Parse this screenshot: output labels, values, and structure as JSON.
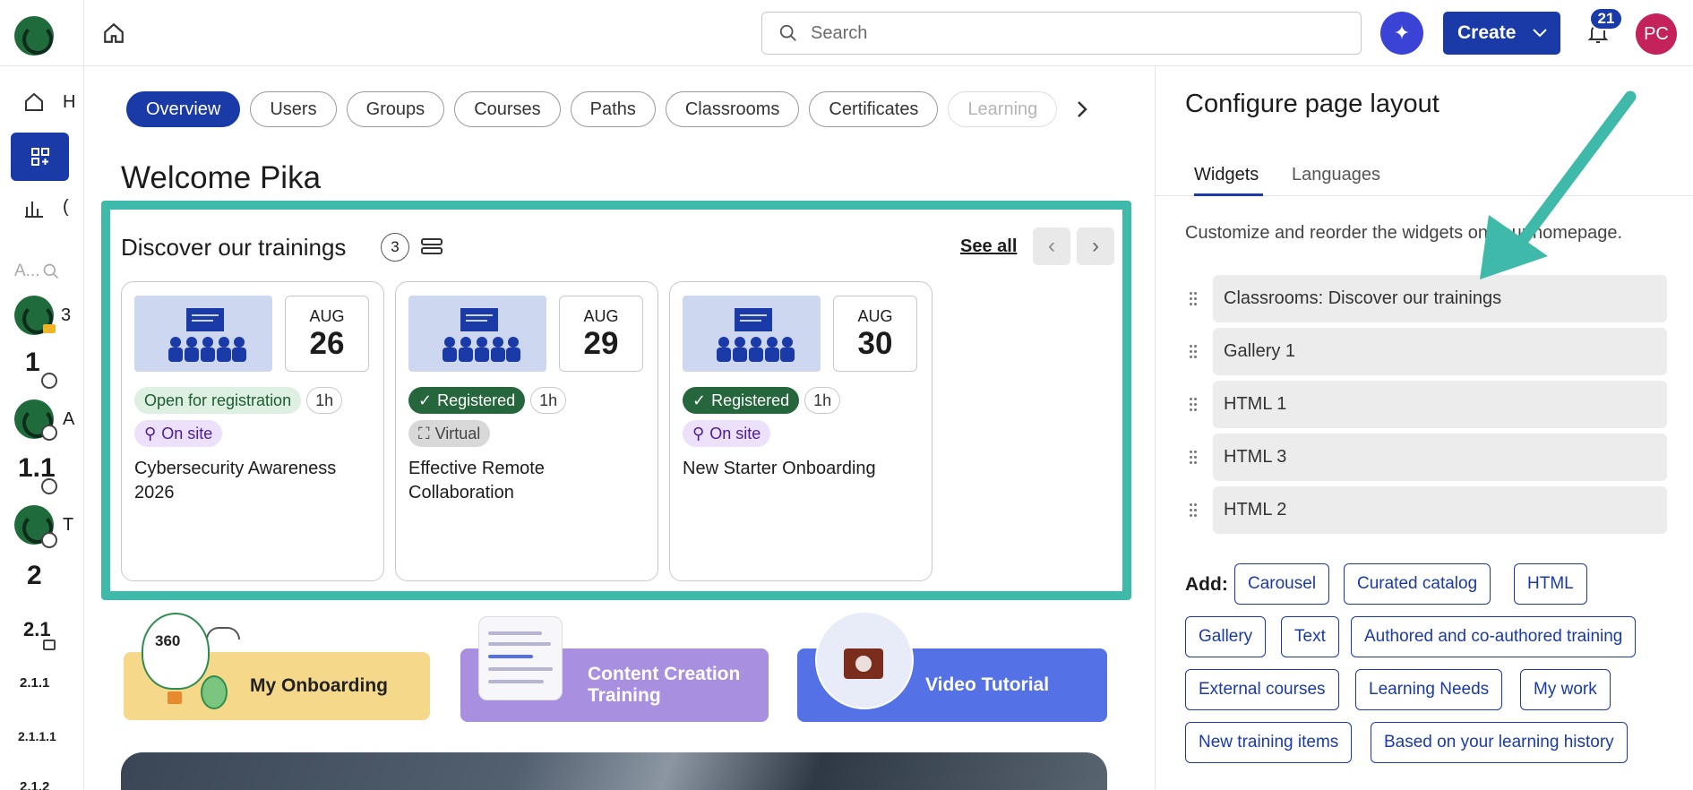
{
  "header": {
    "search_placeholder": "Search",
    "create_label": "Create",
    "notifications_count": "21",
    "avatar_initials": "PC"
  },
  "sidebar": {
    "items": [
      {
        "label": "H"
      },
      {
        "label": ""
      },
      {
        "label": "("
      },
      {
        "label": "A..."
      }
    ],
    "entries": [
      {
        "label": "3"
      },
      {
        "label": "1"
      },
      {
        "label": "A"
      },
      {
        "label": "1.1"
      },
      {
        "label": "T"
      },
      {
        "label": "2"
      },
      {
        "label": "2.1"
      },
      {
        "label": "2.1.1"
      },
      {
        "label": "2.1.1.1"
      },
      {
        "label": "2.1.2"
      }
    ]
  },
  "tabs": [
    "Overview",
    "Users",
    "Groups",
    "Courses",
    "Paths",
    "Classrooms",
    "Certificates",
    "Learning"
  ],
  "welcome": "Welcome Pika",
  "widget": {
    "title": "Discover our trainings",
    "count": "3",
    "see_all": "See all",
    "cards": [
      {
        "month": "AUG",
        "day": "26",
        "status": "Open for registration",
        "duration": "1h",
        "mode": "On site",
        "title": "Cybersecurity Awareness 2026"
      },
      {
        "month": "AUG",
        "day": "29",
        "status": "Registered",
        "duration": "1h",
        "mode": "Virtual",
        "title": "Effective Remote Collaboration"
      },
      {
        "month": "AUG",
        "day": "30",
        "status": "Registered",
        "duration": "1h",
        "mode": "On site",
        "title": "New Starter Onboarding"
      }
    ]
  },
  "banners": {
    "b1": "My Onboarding",
    "b1_badge": "360",
    "b2": "Content Creation Training",
    "b3": "Video Tutorial"
  },
  "panel": {
    "title": "Configure page layout",
    "tab_widgets": "Widgets",
    "tab_languages": "Languages",
    "description": "Customize and reorder the widgets on your homepage.",
    "widget_list": [
      "Classrooms: Discover our trainings",
      "Gallery 1",
      "HTML 1",
      "HTML 3",
      "HTML 2"
    ],
    "add_label": "Add:",
    "add_options": [
      "Carousel",
      "Curated catalog",
      "HTML",
      "Gallery",
      "Text",
      "Authored and co-authored training",
      "External courses",
      "Learning Needs",
      "My work",
      "New training items",
      "Based on your learning history"
    ]
  },
  "colors": {
    "accent": "#1a3aa8",
    "highlight_border": "#3fb9a9",
    "arrow": "#3fb9a9",
    "registered": "#25663c"
  }
}
